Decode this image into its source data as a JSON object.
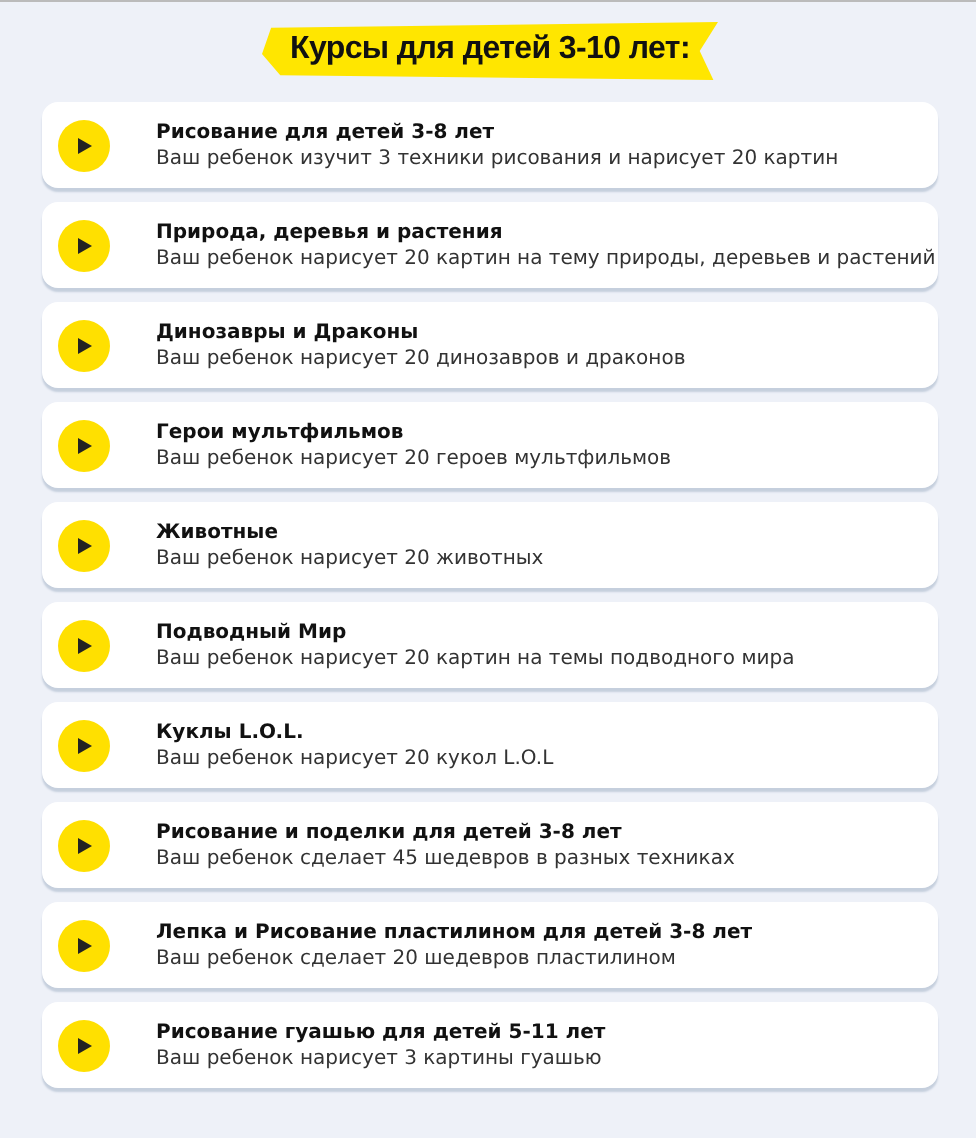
{
  "heading": "Курсы для детей 3-10 лет:",
  "courses": [
    {
      "title": "Рисование для детей 3-8 лет",
      "description": "Ваш ребенок изучит 3 техники рисования и нарисует 20 картин"
    },
    {
      "title": "Природа, деревья и растения",
      "description": "Ваш ребенок нарисует 20 картин на тему природы, деревьев и растений"
    },
    {
      "title": "Динозавры и Драконы",
      "description": "Ваш ребенок нарисует 20 динозавров и драконов"
    },
    {
      "title": "Герои мультфильмов",
      "description": "Ваш ребенок нарисует 20 героев мультфильмов"
    },
    {
      "title": "Животные",
      "description": "Ваш ребенок нарисует 20 животных"
    },
    {
      "title": "Подводный Мир",
      "description": "Ваш ребенок нарисует 20 картин на темы подводного мира"
    },
    {
      "title": "Куклы L.O.L.",
      "description": "Ваш ребенок нарисует 20 кукол L.O.L"
    },
    {
      "title": "Рисование и поделки для детей 3-8 лет",
      "description": "Ваш ребенок сделает 45 шедевров в разных техниках"
    },
    {
      "title": "Лепка и Рисование пластилином для детей 3-8 лет",
      "description": "Ваш ребенок сделает 20 шедевров пластилином"
    },
    {
      "title": "Рисование гуашью для детей 5-11 лет",
      "description": "Ваш ребенок нарисует 3 картины гуашью"
    }
  ]
}
